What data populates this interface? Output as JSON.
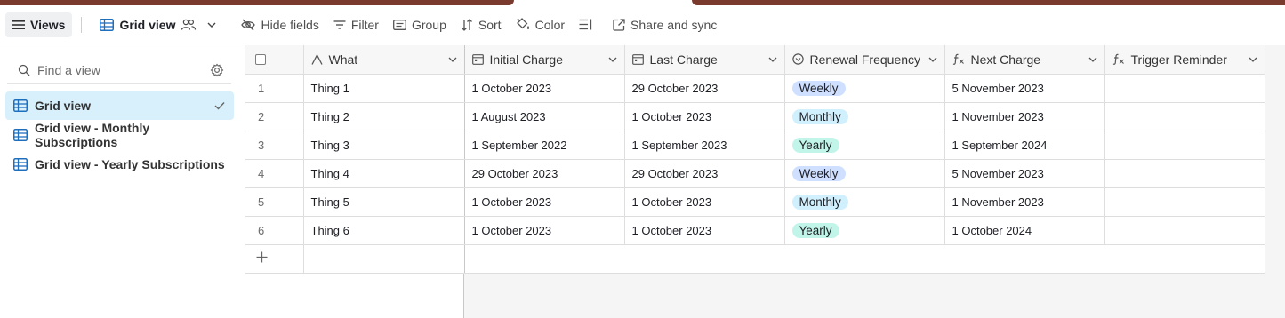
{
  "toolbar": {
    "views_label": "Views",
    "grid_view_label": "Grid view",
    "hide_fields_label": "Hide fields",
    "filter_label": "Filter",
    "group_label": "Group",
    "sort_label": "Sort",
    "color_label": "Color",
    "share_label": "Share and sync"
  },
  "sidebar": {
    "search_placeholder": "Find a view",
    "views": [
      {
        "label": "Grid view",
        "active": true
      },
      {
        "label": "Grid view - Monthly Subscriptions",
        "active": false
      },
      {
        "label": "Grid view - Yearly Subscriptions",
        "active": false
      }
    ]
  },
  "grid": {
    "columns": [
      "What",
      "Initial Charge",
      "Last Charge",
      "Renewal Frequency",
      "Next Charge",
      "Trigger Reminder"
    ],
    "rows": [
      {
        "num": "1",
        "what": "Thing 1",
        "initial": "1 October 2023",
        "last": "29 October 2023",
        "freq": "Weekly",
        "next": "5 November 2023",
        "trigger": ""
      },
      {
        "num": "2",
        "what": "Thing 2",
        "initial": "1 August 2023",
        "last": "1 October 2023",
        "freq": "Monthly",
        "next": "1 November 2023",
        "trigger": ""
      },
      {
        "num": "3",
        "what": "Thing 3",
        "initial": "1 September 2022",
        "last": "1 September 2023",
        "freq": "Yearly",
        "next": "1 September 2024",
        "trigger": ""
      },
      {
        "num": "4",
        "what": "Thing 4",
        "initial": "29 October 2023",
        "last": "29 October 2023",
        "freq": "Weekly",
        "next": "5 November 2023",
        "trigger": ""
      },
      {
        "num": "5",
        "what": "Thing 5",
        "initial": "1 October 2023",
        "last": "1 October 2023",
        "freq": "Monthly",
        "next": "1 November 2023",
        "trigger": ""
      },
      {
        "num": "6",
        "what": "Thing 6",
        "initial": "1 October 2023",
        "last": "1 October 2023",
        "freq": "Yearly",
        "next": "1 October 2024",
        "trigger": ""
      }
    ]
  },
  "colors": {
    "accent": "#7a3b2e",
    "weekly_pill": "#cfdfff",
    "monthly_pill": "#d0f0fd",
    "yearly_pill": "#c2f5e9",
    "active_view_bg": "#d7f0fb",
    "grid_icon": "#1f6fbf"
  }
}
